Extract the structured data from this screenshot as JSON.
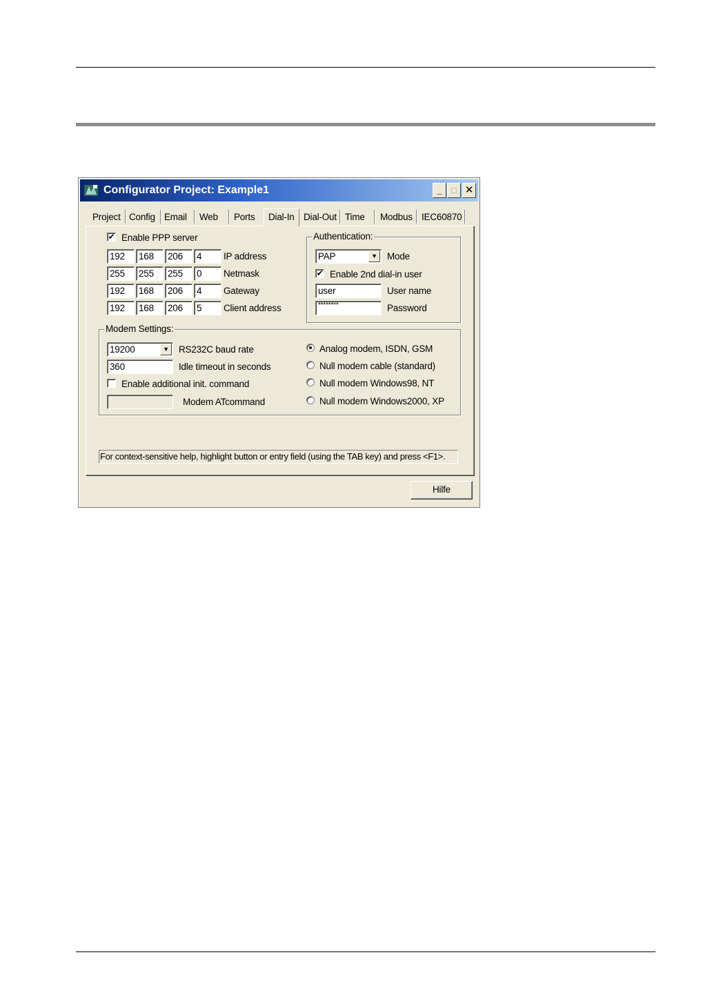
{
  "window": {
    "title": "Configurator Project: Example1",
    "buttons": {
      "minimize": "_",
      "maximize": "□",
      "close": "✕"
    }
  },
  "tabs": [
    "Project",
    "Config",
    "Email",
    "Web",
    "Ports",
    "Dial-In",
    "Dial-Out",
    "Time",
    "Modbus",
    "IEC60870"
  ],
  "active_tab": "Dial-In",
  "ppp": {
    "enable_label": "Enable PPP server",
    "enabled": true,
    "rows": [
      {
        "label": "IP address",
        "octets": [
          "192",
          "168",
          "206",
          "4"
        ]
      },
      {
        "label": "Netmask",
        "octets": [
          "255",
          "255",
          "255",
          "0"
        ]
      },
      {
        "label": "Gateway",
        "octets": [
          "192",
          "168",
          "206",
          "4"
        ]
      },
      {
        "label": "Client address",
        "octets": [
          "192",
          "168",
          "206",
          "5"
        ]
      }
    ]
  },
  "auth": {
    "title": "Authentication:",
    "mode_value": "PAP",
    "mode_label": "Mode",
    "enable2_label": "Enable 2nd dial-in user",
    "enable2_checked": true,
    "username_value": "user",
    "username_label": "User name",
    "password_value": "********",
    "password_label": "Password"
  },
  "modem": {
    "title": "Modem Settings:",
    "baud_value": "19200",
    "baud_label": "RS232C baud rate",
    "idle_value": "360",
    "idle_label": "Idle timeout in seconds",
    "init_label": "Enable additional init. command",
    "init_checked": false,
    "at_value": "",
    "at_label": "Modem ATcommand",
    "options": [
      {
        "label": "Analog modem, ISDN, GSM",
        "selected": true
      },
      {
        "label": "Null modem cable (standard)",
        "selected": false
      },
      {
        "label": "Null modem Windows98, NT",
        "selected": false
      },
      {
        "label": "Null modem Windows2000, XP",
        "selected": false
      }
    ]
  },
  "hint": "For context-sensitive help, highlight button or entry field (using the TAB key) and press <F1>.",
  "help_button": "Hilfe",
  "icons": {
    "app": "app-icon",
    "check": "✔",
    "combo": "▼"
  }
}
